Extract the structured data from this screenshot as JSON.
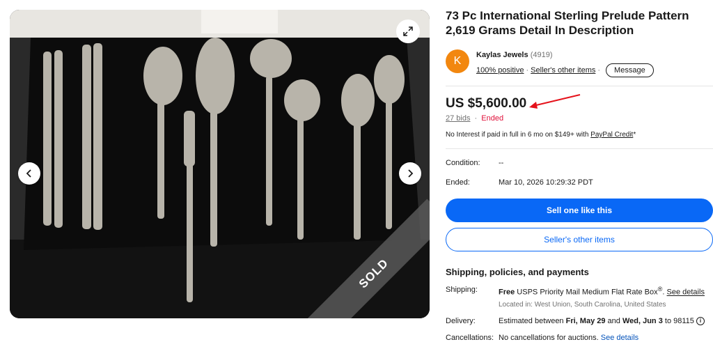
{
  "listing": {
    "title": "73 Pc International Sterling Prelude Pattern 2,619 Grams Detail In Description",
    "sold_label": "SOLD"
  },
  "seller": {
    "initial": "K",
    "name": "Kaylas Jewels",
    "feedback_count": "(4919)",
    "positive": "100% positive",
    "other_items_link": "Seller's other items",
    "message_button": "Message",
    "avatar_color": "#f2870f"
  },
  "price": {
    "amount": "US $5,600.00",
    "bids": "27 bids",
    "separator": "·",
    "status": "Ended",
    "credit_text": "No Interest if paid in full in 6 mo on $149+ with ",
    "credit_link": "PayPal Credit",
    "credit_suffix": "*"
  },
  "specs": {
    "condition_label": "Condition:",
    "condition_value": "--",
    "ended_label": "Ended:",
    "ended_value": "Mar 10, 2026 10:29:32 PDT"
  },
  "actions": {
    "sell_one_like_this": "Sell one like this",
    "sellers_other_items": "Seller's other items"
  },
  "shipping": {
    "section_title": "Shipping, policies, and payments",
    "shipping_label": "Shipping:",
    "shipping_free": "Free",
    "shipping_service": " USPS Priority Mail Medium Flat Rate Box",
    "shipping_reg": "®",
    "shipping_see_details": "See details",
    "location": "Located in: West Union, South Carolina, United States",
    "delivery_label": "Delivery:",
    "delivery_prefix": "Estimated between ",
    "delivery_start": "Fri, May 29",
    "delivery_and": " and ",
    "delivery_end": "Wed, Jun 3",
    "delivery_suffix": " to 98115 ",
    "cancellations_label": "Cancellations:",
    "cancellations_text": "No cancellations for auctions. ",
    "cancellations_link": "See details"
  },
  "colors": {
    "primary_blue": "#0968f6",
    "ended_red": "#e0103a",
    "arrow_red": "#e5121b"
  },
  "icons": [
    "expand-icon",
    "chevron-left-icon",
    "chevron-right-icon",
    "info-icon",
    "arrow-annotation-icon"
  ]
}
